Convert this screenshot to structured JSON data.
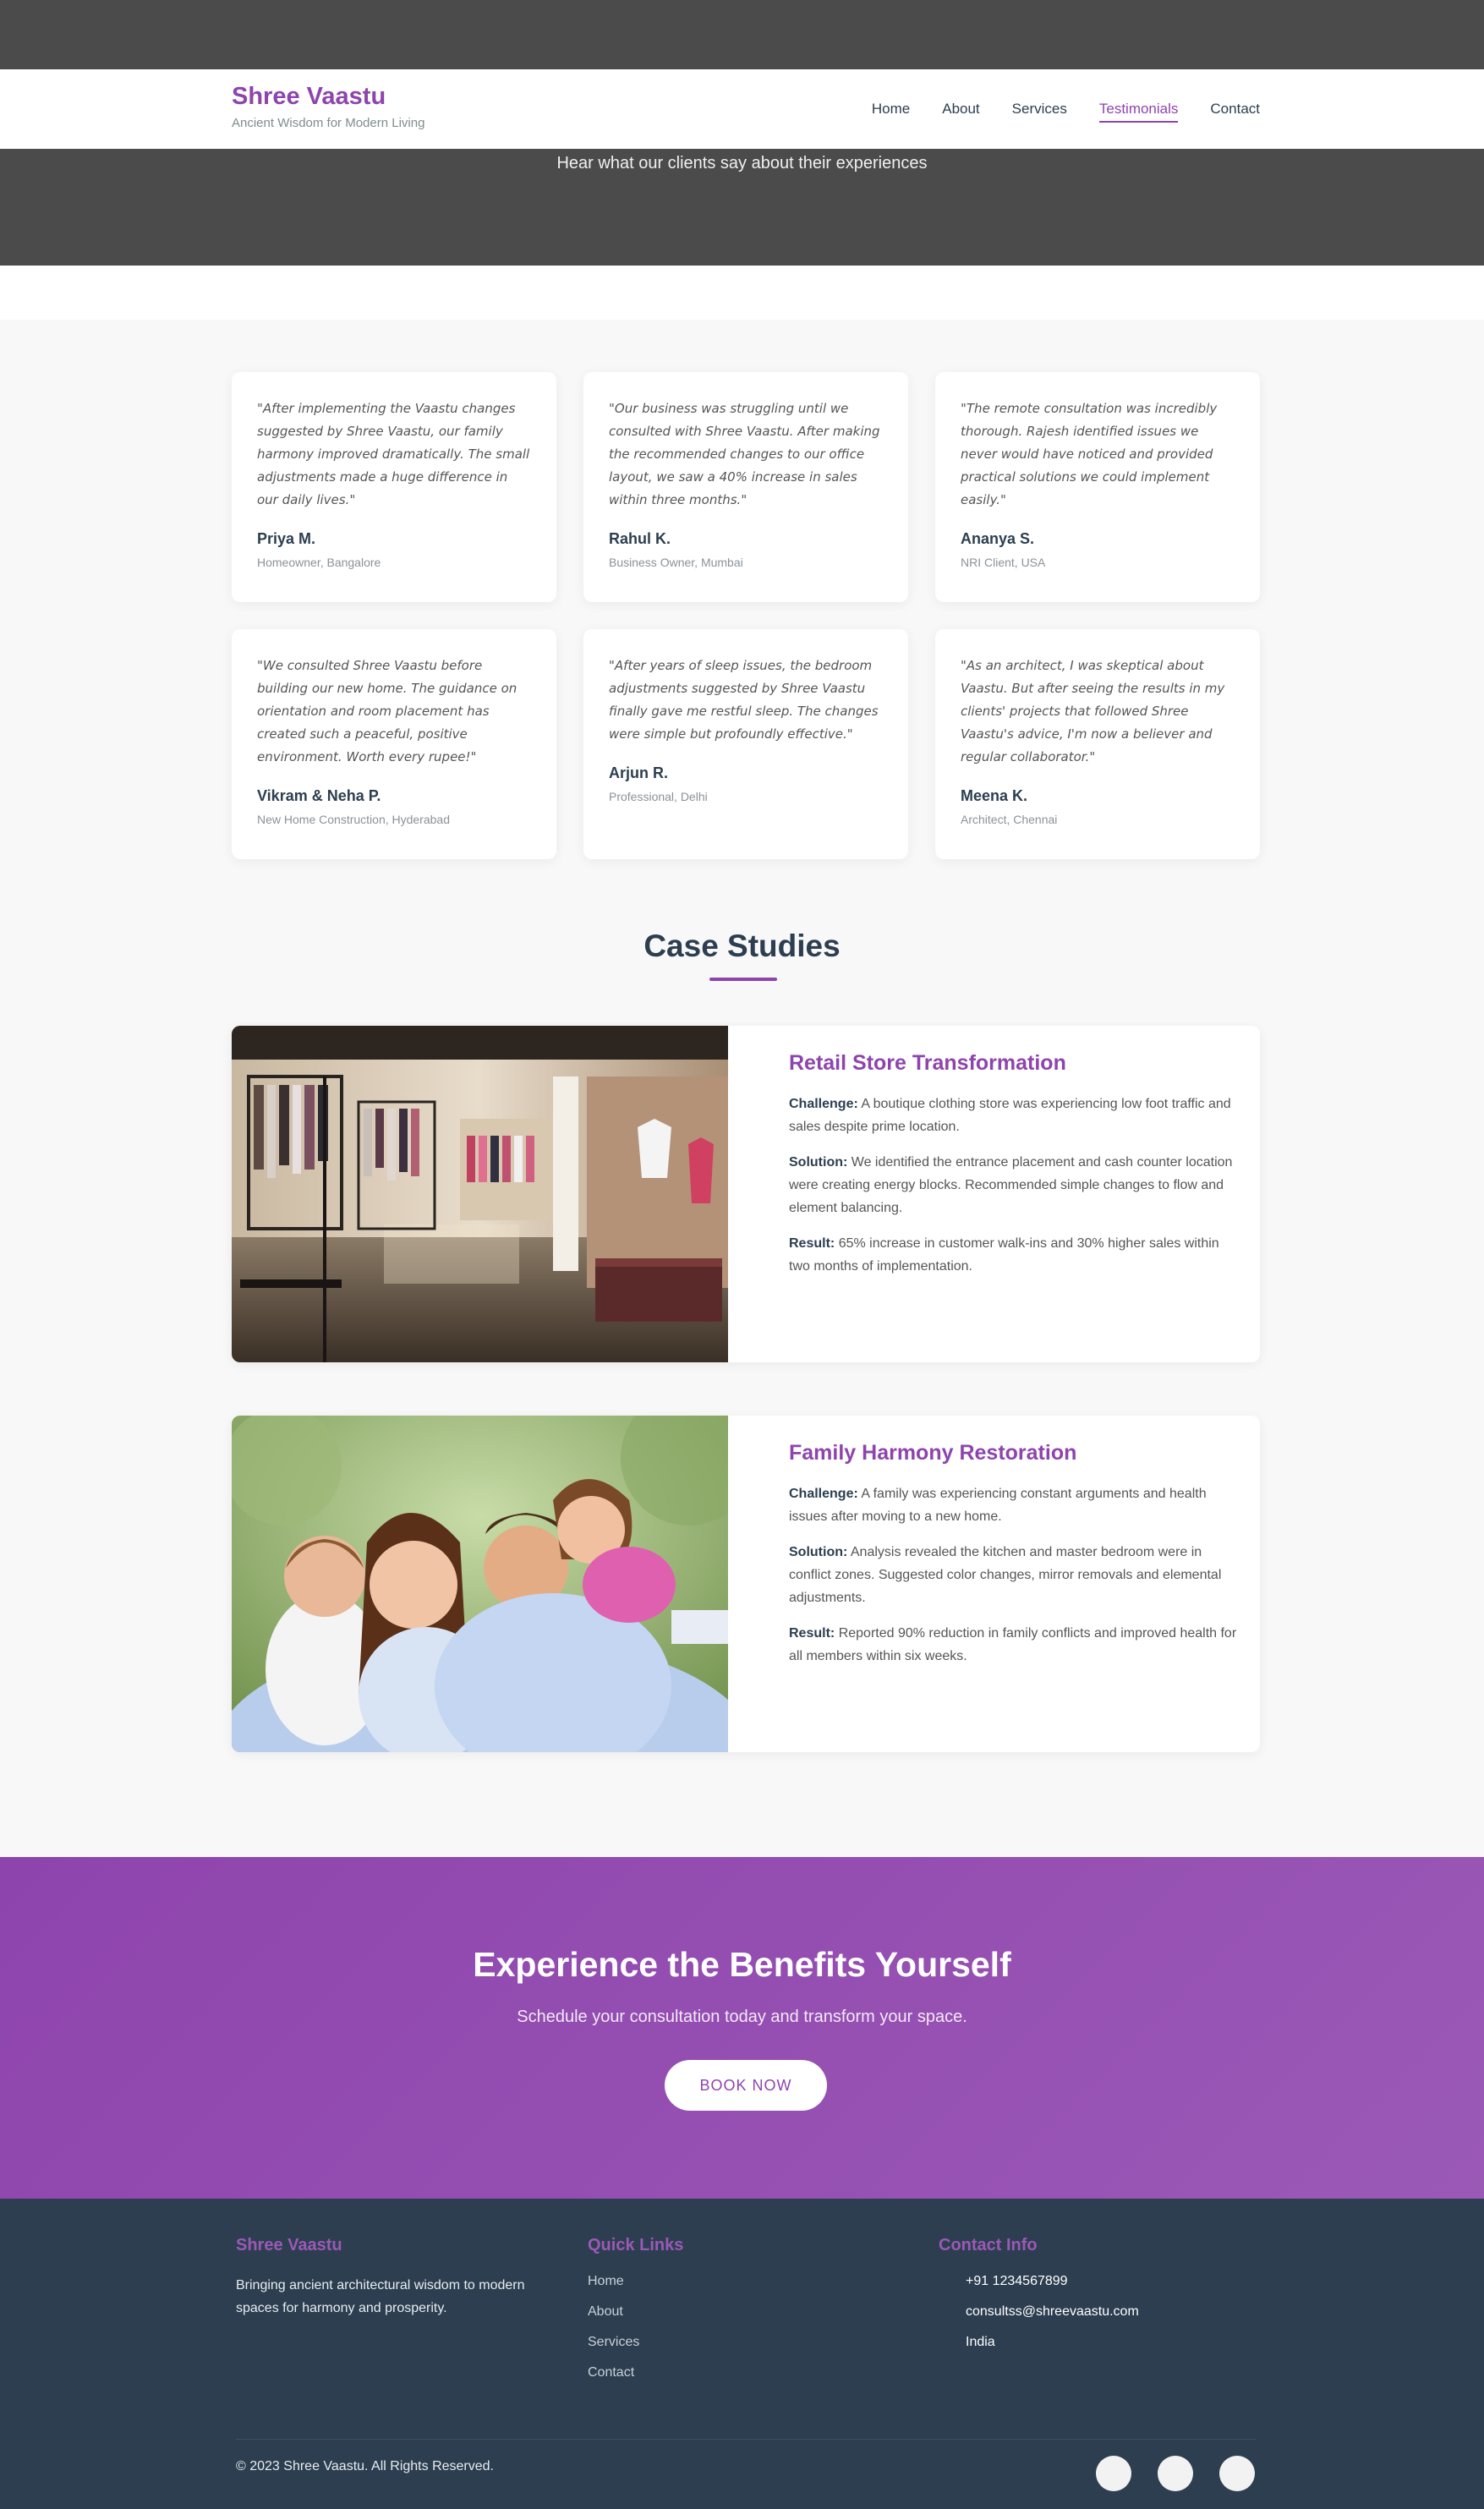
{
  "header": {
    "brand": "Shree Vaastu",
    "tagline": "Ancient Wisdom for Modern Living",
    "nav": [
      "Home",
      "About",
      "Services",
      "Testimonials",
      "Contact"
    ],
    "active_nav": "Testimonials"
  },
  "hero": {
    "subtitle": "Hear what our clients say about their experiences"
  },
  "testimonials": [
    {
      "quote": "\"After implementing the Vaastu changes suggested by Shree Vaastu, our family harmony improved dramatically. The small adjustments made a huge difference in our daily lives.\"",
      "name": "Priya M.",
      "role": "Homeowner, Bangalore"
    },
    {
      "quote": "\"Our business was struggling until we consulted with Shree Vaastu. After making the recommended changes to our office layout, we saw a 40% increase in sales within three months.\"",
      "name": "Rahul K.",
      "role": "Business Owner, Mumbai"
    },
    {
      "quote": "\"The remote consultation was incredibly thorough. Rajesh identified issues we never would have noticed and provided practical solutions we could implement easily.\"",
      "name": "Ananya S.",
      "role": "NRI Client, USA"
    },
    {
      "quote": "\"We consulted Shree Vaastu before building our new home. The guidance on orientation and room placement has created such a peaceful, positive environment. Worth every rupee!\"",
      "name": "Vikram & Neha P.",
      "role": "New Home Construction, Hyderabad"
    },
    {
      "quote": "\"After years of sleep issues, the bedroom adjustments suggested by Shree Vaastu finally gave me restful sleep. The changes were simple but profoundly effective.\"",
      "name": "Arjun R.",
      "role": "Professional, Delhi"
    },
    {
      "quote": "\"As an architect, I was skeptical about Vaastu. But after seeing the results in my clients' projects that followed Shree Vaastu's advice, I'm now a believer and regular collaborator.\"",
      "name": "Meena K.",
      "role": "Architect, Chennai"
    }
  ],
  "case_studies": {
    "title": "Case Studies",
    "labels": {
      "challenge": "Challenge:",
      "solution": "Solution:",
      "result": "Result:"
    },
    "items": [
      {
        "title": "Retail Store Transformation",
        "challenge": "A boutique clothing store was experiencing low foot traffic and sales despite prime location.",
        "solution": "We identified the entrance placement and cash counter location were creating energy blocks. Recommended simple changes to flow and element balancing.",
        "result": "65% increase in customer walk-ins and 30% higher sales within two months of implementation."
      },
      {
        "title": "Family Harmony Restoration",
        "challenge": "A family was experiencing constant arguments and health issues after moving to a new home.",
        "solution": "Analysis revealed the kitchen and master bedroom were in conflict zones. Suggested color changes, mirror removals and elemental adjustments.",
        "result": "Reported 90% reduction in family conflicts and improved health for all members within six weeks."
      }
    ]
  },
  "cta": {
    "title": "Experience the Benefits Yourself",
    "subtitle": "Schedule your consultation today and transform your space.",
    "button": "BOOK NOW"
  },
  "footer": {
    "about_heading": "Shree Vaastu",
    "about_text": "Bringing ancient architectural wisdom to modern spaces for harmony and prosperity.",
    "links_heading": "Quick Links",
    "links": [
      "Home",
      "About",
      "Services",
      "Contact"
    ],
    "contact_heading": "Contact Info",
    "phone": "+91 1234567899",
    "email": "consultss@shreevaastu.com",
    "country": "India",
    "copyright": "© 2023 Shree Vaastu. All Rights Reserved."
  },
  "colors": {
    "accent": "#8e44ad",
    "dark": "#2c3e50",
    "hero_bg": "#4b4b4b"
  }
}
